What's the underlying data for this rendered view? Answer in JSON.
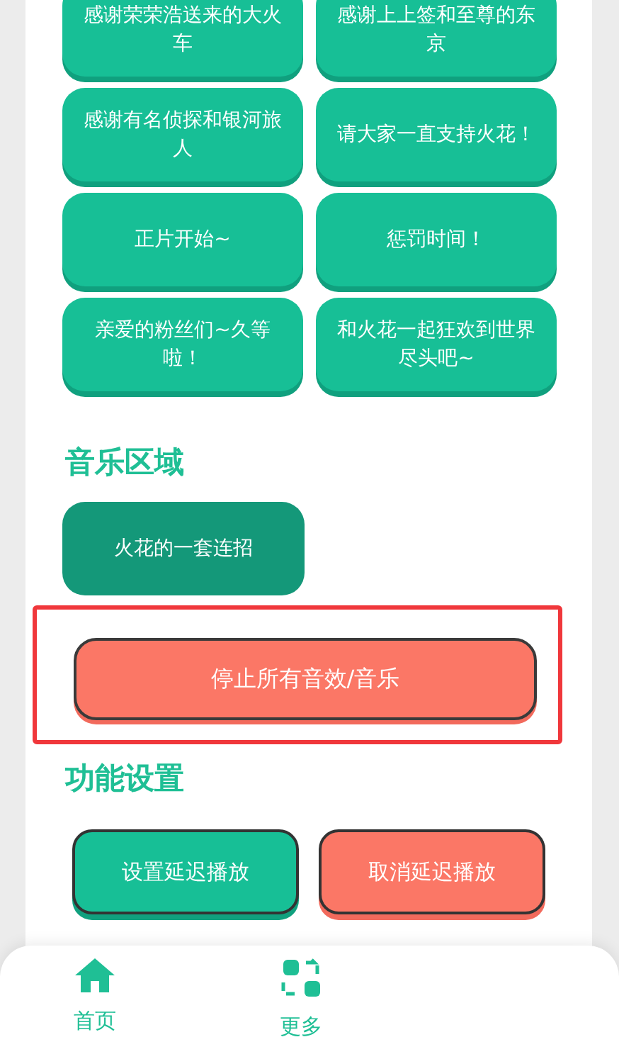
{
  "voice_buttons": [
    {
      "label": "感谢荣荣浩送来的大火车"
    },
    {
      "label": "感谢上上签和至尊的东京"
    },
    {
      "label": "感谢有名侦探和银河旅人"
    },
    {
      "label": "请大家一直支持火花！"
    },
    {
      "label": "正片开始~"
    },
    {
      "label": "惩罚时间！"
    },
    {
      "label": "亲爱的粉丝们~久等啦！"
    },
    {
      "label": "和火花一起狂欢到世界尽头吧~"
    }
  ],
  "music_section": {
    "title": "音乐区域",
    "buttons": [
      {
        "label": "火花的一套连招"
      }
    ]
  },
  "stop_button": {
    "label": "停止所有音效/音乐",
    "highlighted": true
  },
  "settings_section": {
    "title": "功能设置",
    "buttons": [
      {
        "label": "设置延迟播放",
        "kind": "primary"
      },
      {
        "label": "取消延迟播放",
        "kind": "danger"
      }
    ]
  },
  "bottom_nav": [
    {
      "label": "首页",
      "kind": "home"
    },
    {
      "label": "更多",
      "kind": "grid"
    }
  ]
}
